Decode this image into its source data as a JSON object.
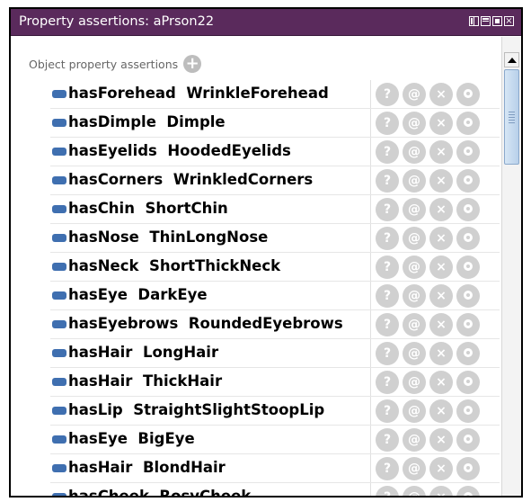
{
  "window": {
    "title": "Property assertions: aPrson22"
  },
  "section": {
    "label": "Object property assertions"
  },
  "assertions": [
    {
      "property": "hasForehead",
      "value": "WrinkleForehead"
    },
    {
      "property": "hasDimple",
      "value": "Dimple"
    },
    {
      "property": "hasEyelids",
      "value": "HoodedEyelids"
    },
    {
      "property": "hasCorners",
      "value": "WrinkledCorners"
    },
    {
      "property": "hasChin",
      "value": "ShortChin"
    },
    {
      "property": "hasNose",
      "value": "ThinLongNose"
    },
    {
      "property": "hasNeck",
      "value": "ShortThickNeck"
    },
    {
      "property": "hasEye",
      "value": "DarkEye"
    },
    {
      "property": "hasEyebrows",
      "value": "RoundedEyebrows"
    },
    {
      "property": "hasHair",
      "value": "LongHair"
    },
    {
      "property": "hasHair",
      "value": "ThickHair"
    },
    {
      "property": "hasLip",
      "value": "StraightSlightStoopLip"
    },
    {
      "property": "hasEye",
      "value": "BigEye"
    },
    {
      "property": "hasHair",
      "value": "BlondHair"
    },
    {
      "property": "hasCheek",
      "value": "RosyCheek"
    }
  ],
  "row_buttons": {
    "explain": "?",
    "annotate": "@",
    "delete": "×"
  },
  "colors": {
    "titlebar": "#5a2a5c",
    "bullet": "#3f6fb0",
    "button": "#d0d0d0"
  },
  "icons": {
    "add": "add-icon",
    "explain": "question-icon",
    "annotate": "at-icon",
    "delete": "delete-icon",
    "edit": "edit-ring-icon"
  }
}
